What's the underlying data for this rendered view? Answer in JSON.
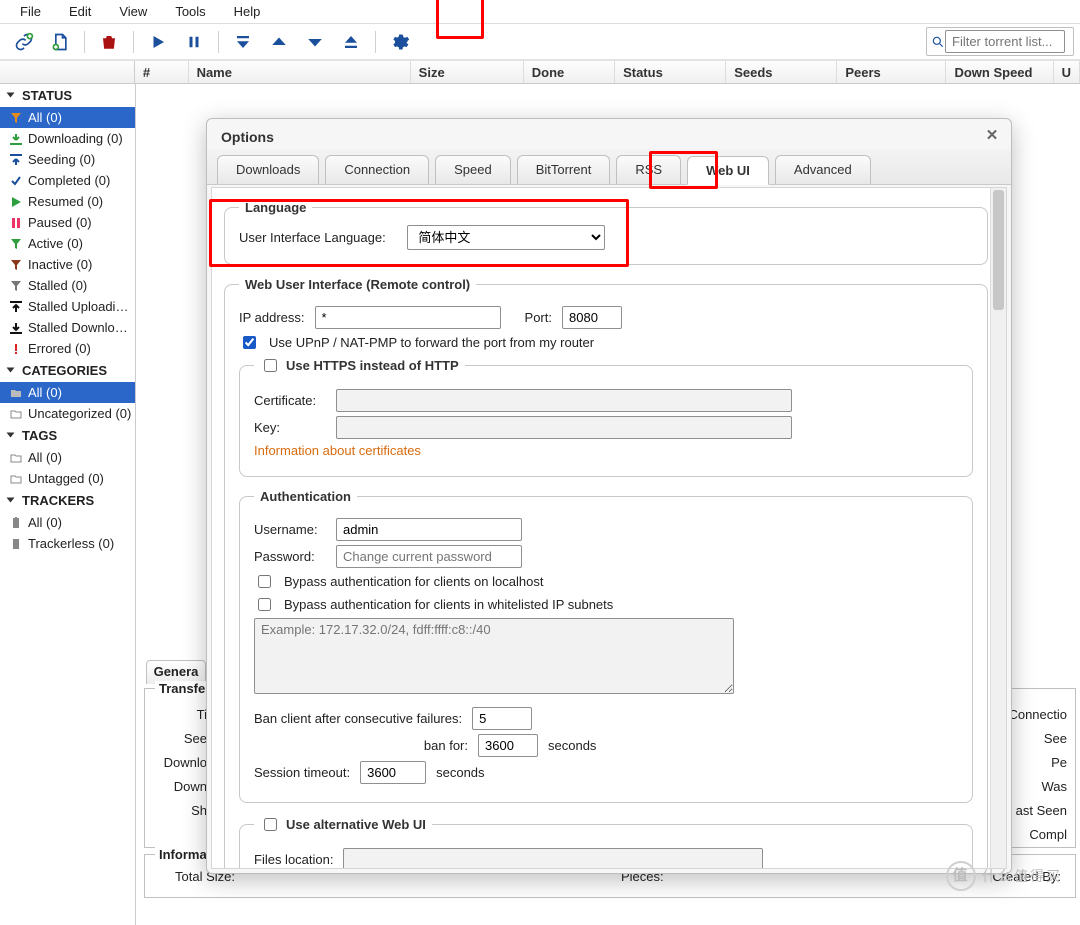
{
  "menu": {
    "file": "File",
    "edit": "Edit",
    "view": "View",
    "tools": "Tools",
    "help": "Help"
  },
  "search": {
    "placeholder": "Filter torrent list..."
  },
  "columns": {
    "num": "#",
    "name": "Name",
    "size": "Size",
    "done": "Done",
    "status": "Status",
    "seeds": "Seeds",
    "peers": "Peers",
    "down": "Down Speed",
    "up": "U"
  },
  "sidebar": {
    "status_hdr": "STATUS",
    "status": [
      {
        "k": "all",
        "label": "All (0)"
      },
      {
        "k": "downloading",
        "label": "Downloading (0)"
      },
      {
        "k": "seeding",
        "label": "Seeding (0)"
      },
      {
        "k": "completed",
        "label": "Completed (0)"
      },
      {
        "k": "resumed",
        "label": "Resumed (0)"
      },
      {
        "k": "paused",
        "label": "Paused (0)"
      },
      {
        "k": "active",
        "label": "Active (0)"
      },
      {
        "k": "inactive",
        "label": "Inactive (0)"
      },
      {
        "k": "stalled",
        "label": "Stalled (0)"
      },
      {
        "k": "stalled_up",
        "label": "Stalled Uploadi…"
      },
      {
        "k": "stalled_dl",
        "label": "Stalled Downlo…"
      },
      {
        "k": "errored",
        "label": "Errored (0)"
      }
    ],
    "categories_hdr": "CATEGORIES",
    "categories": [
      {
        "k": "all",
        "label": "All (0)"
      },
      {
        "k": "uncat",
        "label": "Uncategorized (0)"
      }
    ],
    "tags_hdr": "TAGS",
    "tags": [
      {
        "k": "all",
        "label": "All (0)"
      },
      {
        "k": "untag",
        "label": "Untagged (0)"
      }
    ],
    "trackers_hdr": "TRACKERS",
    "trackers": [
      {
        "k": "all",
        "label": "All (0)"
      },
      {
        "k": "trackerless",
        "label": "Trackerless (0)"
      }
    ]
  },
  "bottom": {
    "tab_general": "Genera",
    "transfer_title": "Transfe",
    "info_title": "Informa",
    "labels": {
      "ti": "Ti",
      "see": "See",
      "downlo": "Downlo",
      "down": "Down",
      "sh": "Sh",
      "totalsize": "Total Size:",
      "pieces": "Pieces:",
      "connectio": "Connectio",
      "see2": "See",
      "pe": "Pe",
      "was": "Was",
      "lastseen": "ast Seen Compl",
      "createdby": "Created By:"
    }
  },
  "dialog": {
    "title": "Options",
    "tabs": {
      "downloads": "Downloads",
      "connection": "Connection",
      "speed": "Speed",
      "bittorrent": "BitTorrent",
      "rss": "RSS",
      "webui": "Web UI",
      "advanced": "Advanced"
    },
    "lang_legend": "Language",
    "lang_label": "User Interface Language:",
    "lang_value": "简体中文",
    "wui_legend": "Web User Interface (Remote control)",
    "ip_label": "IP address:",
    "ip_value": "*",
    "port_label": "Port:",
    "port_value": "8080",
    "upnp": "Use UPnP / NAT-PMP to forward the port from my router",
    "https_legend": "Use HTTPS instead of HTTP",
    "cert": "Certificate:",
    "key": "Key:",
    "cert_link": "Information about certificates",
    "auth_legend": "Authentication",
    "user_label": "Username:",
    "user_value": "admin",
    "pass_label": "Password:",
    "pass_placeholder": "Change current password",
    "bypass_local": "Bypass authentication for clients on localhost",
    "bypass_white": "Bypass authentication for clients in whitelisted IP subnets",
    "subnet_placeholder": "Example: 172.17.32.0/24, fdff:ffff:c8::/40",
    "ban_label": "Ban client after consecutive failures:",
    "ban_value": "5",
    "banfor_label": "ban for:",
    "banfor_value": "3600",
    "seconds": "seconds",
    "session_label": "Session timeout:",
    "session_value": "3600",
    "altui_legend": "Use alternative Web UI",
    "files_loc": "Files location:"
  },
  "watermark": "什么值得买"
}
